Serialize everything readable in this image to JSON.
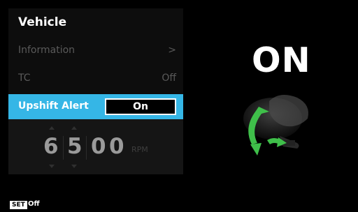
{
  "panel": {
    "title": "Vehicle",
    "items": [
      {
        "label": "Information",
        "value": ">"
      },
      {
        "label": "TC",
        "value": "Off"
      },
      {
        "label": "Upshift Alert",
        "value": "On"
      }
    ]
  },
  "rpm": {
    "digits": [
      "6",
      "5",
      "0",
      "0"
    ],
    "unit": "RPM"
  },
  "status": {
    "big_label": "ON"
  },
  "footer": {
    "badge": "SET",
    "value": "Off"
  },
  "colors": {
    "accent": "#35b6e6",
    "arrow_green": "#3fbf4a"
  }
}
